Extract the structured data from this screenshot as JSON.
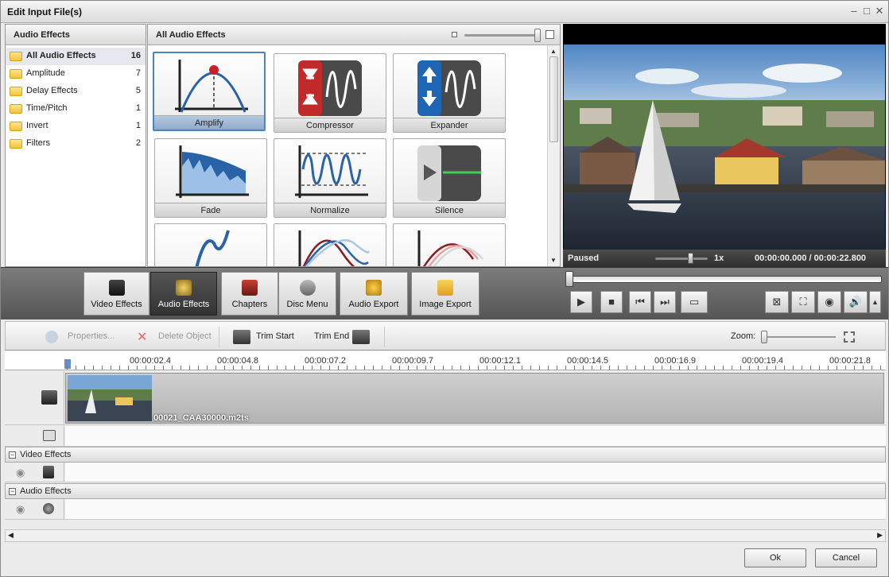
{
  "window": {
    "title": "Edit Input File(s)"
  },
  "categories": {
    "header": "Audio Effects",
    "items": [
      {
        "label": "All Audio Effects",
        "count": "16"
      },
      {
        "label": "Amplitude",
        "count": "7"
      },
      {
        "label": "Delay Effects",
        "count": "5"
      },
      {
        "label": "Time/Pitch",
        "count": "1"
      },
      {
        "label": "Invert",
        "count": "1"
      },
      {
        "label": "Filters",
        "count": "2"
      }
    ]
  },
  "effects": {
    "header": "All Audio Effects",
    "tiles": [
      "Amplify",
      "Compressor",
      "Expander",
      "Fade",
      "Normalize",
      "Silence"
    ]
  },
  "preview": {
    "status": "Paused",
    "speed": "1x",
    "time": "00:00:00.000 / 00:00:22.800"
  },
  "toolbar": {
    "video_effects": "Video Effects",
    "audio_effects": "Audio Effects",
    "chapters": "Chapters",
    "disc_menu": "Disc Menu",
    "audio_export": "Audio Export",
    "image_export": "Image Export"
  },
  "editbar": {
    "properties": "Properties...",
    "delete_object": "Delete Object",
    "trim_start": "Trim Start",
    "trim_end": "Trim End",
    "zoom_label": "Zoom:"
  },
  "timeline": {
    "ticks": [
      "00:00:02.4",
      "00:00:04.8",
      "00:00:07.2",
      "00:00:09.7",
      "00:00:12.1",
      "00:00:14.5",
      "00:00:16.9",
      "00:00:19.4",
      "00:00:21.8"
    ],
    "clip_name": "00021_CAA30000.m2ts",
    "video_effects_group": "Video Effects",
    "audio_effects_group": "Audio Effects"
  },
  "dialog": {
    "ok": "Ok",
    "cancel": "Cancel"
  },
  "colors": {
    "accent": "#4a84c2",
    "effect_blue": "#2a62a8",
    "effect_red": "#c8202a"
  }
}
